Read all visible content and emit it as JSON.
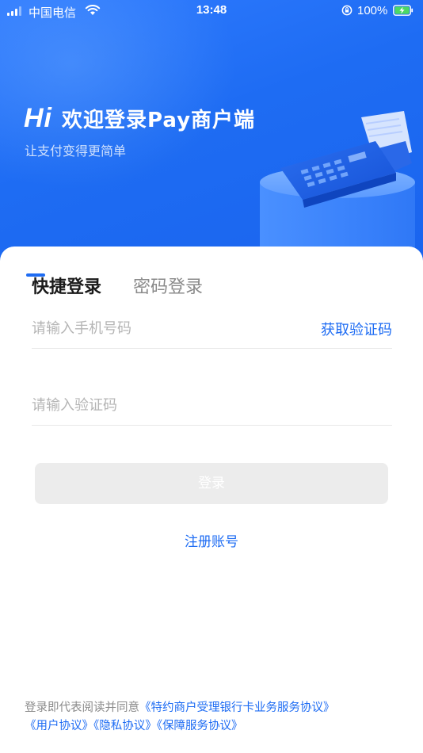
{
  "status_bar": {
    "carrier": "中国电信",
    "time": "13:48",
    "battery_percent": "100%"
  },
  "hero": {
    "hi": "Hi",
    "welcome": "欢迎登录Pay商户端",
    "subtitle": "让支付变得更简单"
  },
  "login": {
    "tabs": [
      {
        "label": "快捷登录",
        "active": true
      },
      {
        "label": "密码登录",
        "active": false
      }
    ],
    "phone_placeholder": "请输入手机号码",
    "get_code_label": "获取验证码",
    "code_placeholder": "请输入验证码",
    "login_button": "登录",
    "register_link": "注册账号"
  },
  "agreement": {
    "prefix": "登录即代表阅读并同意",
    "links": [
      "《特约商户受理银行卡业务服务协议》",
      "《用户协议》",
      "《隐私协议》",
      "《保障服务协议》"
    ]
  },
  "colors": {
    "brand_blue": "#1e6cf3",
    "button_disabled": "#ececec",
    "placeholder": "#b5b5b5"
  }
}
